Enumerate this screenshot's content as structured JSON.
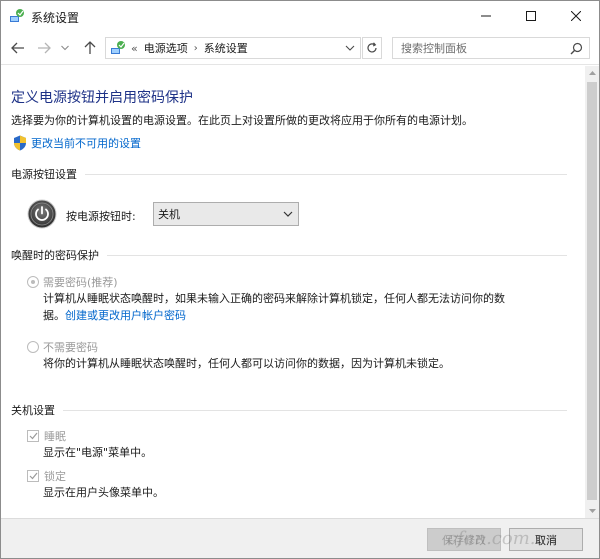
{
  "window": {
    "title": "系统设置"
  },
  "navbar": {
    "breadcrumb_prefix": "«",
    "crumbs": [
      "电源选项",
      "系统设置"
    ],
    "search_placeholder": "搜索控制面板"
  },
  "content": {
    "page_title": "定义电源按钮并启用密码保护",
    "intro": "选择要为你的计算机设置的电源设置。在此页上对设置所做的更改将应用于你所有的电源计划。",
    "change_link": "更改当前不可用的设置",
    "power_section": {
      "heading": "电源按钮设置",
      "label": "按电源按钮时:",
      "selected_value": "关机"
    },
    "password_section": {
      "heading": "唤醒时的密码保护",
      "require": {
        "label": "需要密码(推荐)",
        "desc_line1": "计算机从睡眠状态唤醒时，如果未输入正确的密码来解除计算机锁定，任何人都无法访问你的数",
        "desc_line2_prefix": "据。",
        "desc_link": "创建或更改用户帐户密码",
        "checked": true
      },
      "no_require": {
        "label": "不需要密码",
        "desc": "将你的计算机从睡眠状态唤醒时，任何人都可以访问你的数据，因为计算机未锁定。",
        "checked": false
      }
    },
    "shutdown_section": {
      "heading": "关机设置",
      "sleep": {
        "label": "睡眠",
        "desc": "显示在\"电源\"菜单中。",
        "checked": true
      },
      "lock": {
        "label": "锁定",
        "desc": "显示在用户头像菜单中。",
        "checked": true
      }
    }
  },
  "footer": {
    "save_label": "保存修改",
    "cancel_label": "取消"
  },
  "watermark": "cfan.com.cn",
  "colors": {
    "title_blue": "#1e3287",
    "link_blue": "#0066cc",
    "disabled_gray": "#9a9a9a"
  }
}
